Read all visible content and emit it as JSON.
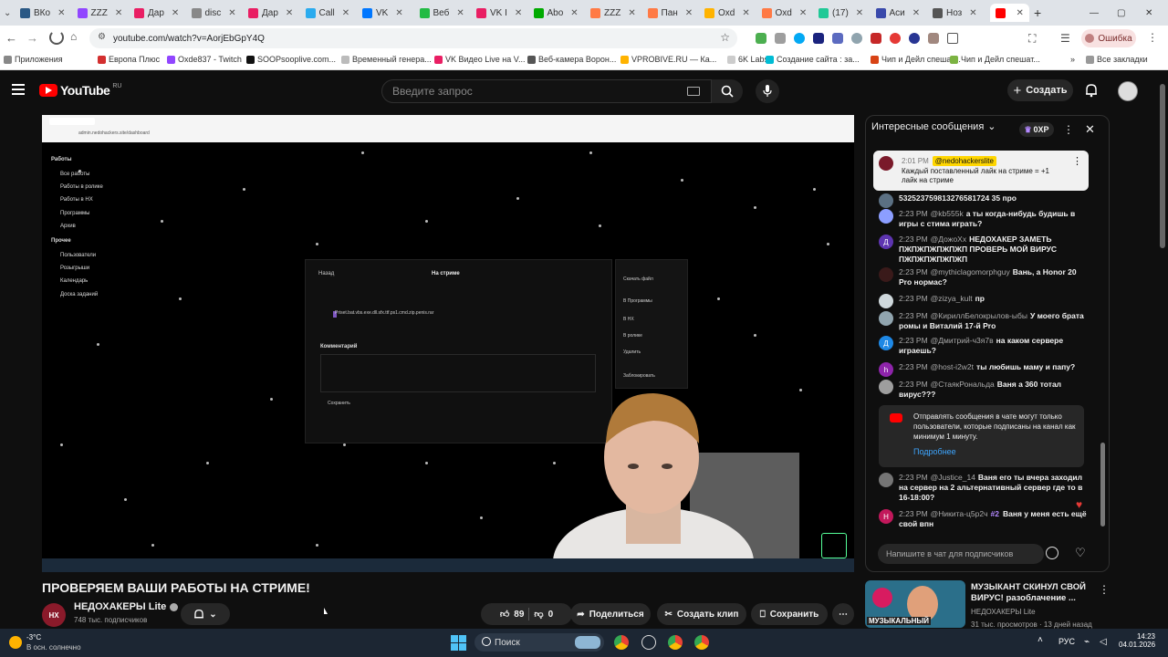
{
  "browser": {
    "tabs": [
      {
        "label": "ВКо",
        "color": "#2a5885"
      },
      {
        "label": "ZZZ",
        "color": "#9146ff"
      },
      {
        "label": "Дар",
        "color": "#e91e63"
      },
      {
        "label": "disc",
        "color": "#888888"
      },
      {
        "label": "Дар",
        "color": "#e91e63"
      },
      {
        "label": "Call",
        "color": "#2aabee"
      },
      {
        "label": "VK",
        "color": "#0077ff"
      },
      {
        "label": "Веб",
        "color": "#22bb44"
      },
      {
        "label": "VK I",
        "color": "#e91e63"
      },
      {
        "label": "Abo",
        "color": "#0a0"
      },
      {
        "label": "ZZZ",
        "color": "#ff7a45"
      },
      {
        "label": "Пан",
        "color": "#ff7a45"
      },
      {
        "label": "Oxd",
        "color": "#ffb300"
      },
      {
        "label": "Oxd",
        "color": "#ff7a45"
      },
      {
        "label": "(17)",
        "color": "#20c997"
      },
      {
        "label": "Аси",
        "color": "#3949ab"
      },
      {
        "label": "Ноз",
        "color": "#555555"
      },
      {
        "label": "",
        "color": "#ff0000"
      }
    ],
    "url": "youtube.com/watch?v=AorjEbGpY4Q",
    "error_label": "Ошибка",
    "bookmarks": [
      {
        "label": "Приложения",
        "color": "#888888"
      },
      {
        "label": "Европа Плюс",
        "color": "#d32f2f"
      },
      {
        "label": "Oxde837 - Twitch",
        "color": "#9146ff"
      },
      {
        "label": "SOOPsooplive.com...",
        "color": "#111111"
      },
      {
        "label": "Временный генера...",
        "color": "#bbbbbb"
      },
      {
        "label": "VK Видео Live на V...",
        "color": "#e91e63"
      },
      {
        "label": "Веб-камера Ворон...",
        "color": "#555555"
      },
      {
        "label": "VPROBIVE.RU — Ка...",
        "color": "#ffb300"
      },
      {
        "label": "6K Labs",
        "color": "#cccccc"
      },
      {
        "label": "Создание сайта : за...",
        "color": "#00bcd4"
      },
      {
        "label": "Чип и Дейл спешат...",
        "color": "#d84315"
      },
      {
        "label": "Чип и Дейл спешат...",
        "color": "#7cb342"
      }
    ],
    "all_bookmarks": "Все закладки"
  },
  "youtube": {
    "logo_text": "YouTube",
    "logo_region": "RU",
    "search_placeholder": "Введите запрос",
    "create_label": "Создать"
  },
  "video": {
    "inner_url": "admin.nedohackers.site/dashboard",
    "sidebar_items": [
      "Работы",
      "Все работы",
      "Работы в ролике",
      "Работы в НХ",
      "Программы",
      "Архив",
      "Прочее",
      "Пользователи",
      "Розыгрыши",
      "Календарь",
      "Доска заданий"
    ],
    "dialog_back": "Назад",
    "dialog_title": "На стриме",
    "dialog_file": "Priset.bat.vbs.exe.dll.sfx.ttf.ps1.cmd.zip.penis.rar",
    "dialog_comment": "Комментарий",
    "dialog_save": "Сохранить",
    "menu_items": [
      "Скачать файл",
      "В Программы",
      "В НХ",
      "В ролике",
      "Удалить",
      "Заблокировать"
    ],
    "title": "ПРОВЕРЯЕМ ВАШИ РАБОТЫ НА СТРИМЕ!",
    "channel": "НЕДОХАКЕРЫ Lite",
    "subscribers": "748 тыс. подписчиков",
    "likes": "89",
    "dislikes": "0",
    "share_label": "Поделиться",
    "clip_label": "Создать клип",
    "save_label": "Сохранить",
    "avatar_text": "НХ"
  },
  "chat": {
    "header": "Интересные сообщения",
    "xp_badge": "0XP",
    "pinned": {
      "time": "2:01 PM",
      "author": "@nedohackerslite",
      "text": "Каждый поставленный лайк на стриме = +1 лайк на стриме"
    },
    "messages": [
      {
        "avatar": "",
        "avatar_color": "#5b7083",
        "time": "",
        "author": "",
        "text": "532523759813276581724 35 про"
      },
      {
        "avatar": "",
        "avatar_color": "#8c9eff",
        "time": "2:23 PM",
        "author": "@kb555k",
        "text": "а ты когда-нибудь будишь в игры с стима играть?"
      },
      {
        "avatar": "Д",
        "avatar_color": "#5e35b1",
        "time": "2:23 PM",
        "author": "@ДожоХх",
        "text": "НЕДОХАКЕР ЗАМЕТЬ ПЖПЖПЖПЖПЖП ПРОВЕРЬ МОЙ ВИРУС ПЖПЖПЖПЖПЖП"
      },
      {
        "avatar": "",
        "avatar_color": "#3a1a1a",
        "time": "2:23 PM",
        "author": "@mythiclagomorphguy",
        "text": "Вань, а Honor 20 Pro нормас?"
      },
      {
        "avatar": "",
        "avatar_color": "#cfd8dc",
        "time": "2:23 PM",
        "author": "@zizya_kult",
        "text": "пр"
      },
      {
        "avatar": "",
        "avatar_color": "#90a4ae",
        "time": "2:23 PM",
        "author": "@КириллБелокрылов-ыбы",
        "text": "У моего брата ромы и Виталий 17-й Pro"
      },
      {
        "avatar": "Д",
        "avatar_color": "#1e88e5",
        "time": "2:23 PM",
        "author": "@Дмитрий-ч3я7в",
        "text": "на каком сервере играешь?"
      },
      {
        "avatar": "h",
        "avatar_color": "#8e24aa",
        "time": "2:23 PM",
        "author": "@host-i2w2t",
        "text": "ты любишь маму и папу?"
      },
      {
        "avatar": "",
        "avatar_color": "#9e9e9e",
        "time": "2:23 PM",
        "author": "@СтаякРональда",
        "text": "Ваня а 360 тотал вирус???"
      },
      {
        "avatar": "",
        "avatar_color": "#757575",
        "time": "2:23 PM",
        "author": "@Justice_14",
        "text": "Ваня его ты вчера заходил на сервер на 2 альтернативный сервер где то в 16-18:00?"
      },
      {
        "avatar": "Н",
        "avatar_color": "#c2185b",
        "time": "2:23 PM",
        "author": "@Никита-ц5р2ч",
        "badge": "#2",
        "text": "Ваня у меня есть ещё свой впн"
      }
    ],
    "notice_text": "Отправлять сообщения в чате могут только пользователи, которые подписаны на канал как минимум 1 минуту.",
    "notice_link": "Подробнее",
    "input_placeholder": "Напишите в чат для подписчиков"
  },
  "recommendation": {
    "title": "МУЗЫКАНТ СКИНУЛ СВОЙ ВИРУС! разоблачение ...",
    "channel": "НЕДОХАКЕРЫ Lite",
    "meta": "31 тыс. просмотров · 13 дней назад",
    "thumb_text": "МУЗЫКАЛЬНЫЙ"
  },
  "taskbar": {
    "weather_temp": "-3°C",
    "weather_desc": "В осн. солнечно",
    "search_label": "Поиск",
    "lang": "РУС",
    "time": "14:23",
    "date": "04.01.2026"
  }
}
